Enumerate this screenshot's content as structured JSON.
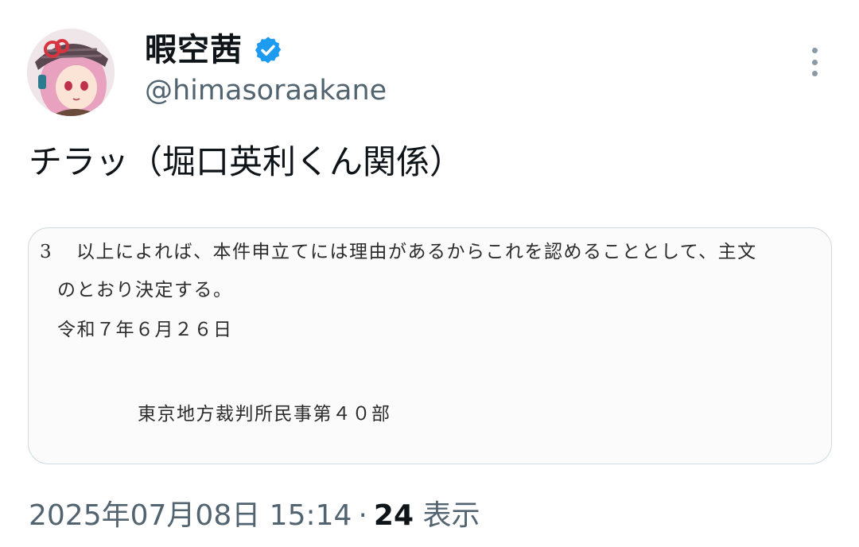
{
  "tweet": {
    "author": {
      "display_name": "暇空茜",
      "handle": "@himasoraakane",
      "verified": true,
      "verified_color": "#1d9bf0",
      "avatar_icon": "avatar-image"
    },
    "text": "チラッ（堀口英利くん関係）",
    "menu_icon": "more-vertical-icon",
    "media": {
      "document": {
        "paragraph_number": "3",
        "line1": "以上によれば、本件申立てには理由があるからこれを認めることとして、主文",
        "line2": "のとおり決定する。",
        "date": "令和７年６月２６日",
        "court": "東京地方裁判所民事第４０部"
      }
    },
    "meta": {
      "timestamp": "2025年07月08日 15:14",
      "separator": "·",
      "view_count": "24",
      "view_label": "表示"
    }
  }
}
